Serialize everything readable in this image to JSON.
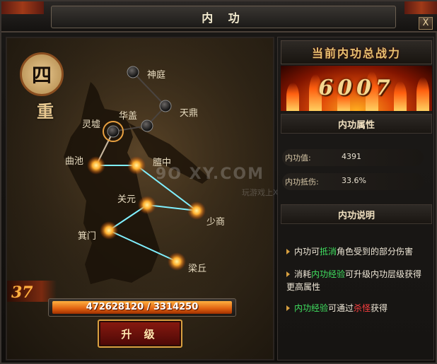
{
  "window": {
    "title": "内 功",
    "close_label": "X"
  },
  "rank": {
    "number_char": "四",
    "suffix_char": "重"
  },
  "meridian": {
    "nodes": [
      {
        "id": "shenting",
        "label": "神庭",
        "state": "locked"
      },
      {
        "id": "tianding",
        "label": "天鼎",
        "state": "locked"
      },
      {
        "id": "huagai",
        "label": "华盖",
        "state": "locked"
      },
      {
        "id": "lingxu",
        "label": "灵墟",
        "state": "selected"
      },
      {
        "id": "quchi",
        "label": "曲池",
        "state": "active"
      },
      {
        "id": "tanzhong",
        "label": "膻中",
        "state": "active"
      },
      {
        "id": "guanyuan",
        "label": "关元",
        "state": "active"
      },
      {
        "id": "shaoshang",
        "label": "少商",
        "state": "active"
      },
      {
        "id": "jimen",
        "label": "箕门",
        "state": "active"
      },
      {
        "id": "liangqiu",
        "label": "梁丘",
        "state": "active"
      }
    ]
  },
  "progress": {
    "level": "37",
    "current_xp": "472628120",
    "required_xp": "3314250",
    "xp_text": "472628120 / 3314250",
    "fill_fraction": 1.0
  },
  "upgrade_button_label": "升 级",
  "power": {
    "title": "当前内功总战力",
    "value": "6007"
  },
  "attributes": {
    "header": "内功属性",
    "rows": [
      {
        "label": "内功值:",
        "value": "4391"
      },
      {
        "label": "内功抵伤:",
        "value": "33.6%"
      }
    ]
  },
  "description": {
    "header": "内功说明",
    "items": [
      {
        "prefix": "内功可",
        "highlight": "抵消",
        "suffix": "角色受到的部分伤害",
        "highlight_color": "green"
      },
      {
        "prefix": "消耗",
        "highlight": "内功经验",
        "suffix": "可升级内功层级获得更高属性",
        "highlight_color": "green"
      },
      {
        "prefix": "",
        "highlight": "内功经验",
        "middle": "可通过",
        "highlight2": "杀怪",
        "suffix": "获得",
        "highlight_color": "green"
      }
    ]
  },
  "watermark": {
    "main": "9O XY.COM",
    "sub": "玩游戏上XY"
  },
  "colors": {
    "accent_gold": "#d8a040",
    "flame_orange": "#e06010",
    "node_active": "#ffb030",
    "link_cyan": "#80f0ff",
    "highlight_green": "#40e060",
    "highlight_red": "#ff4040"
  }
}
